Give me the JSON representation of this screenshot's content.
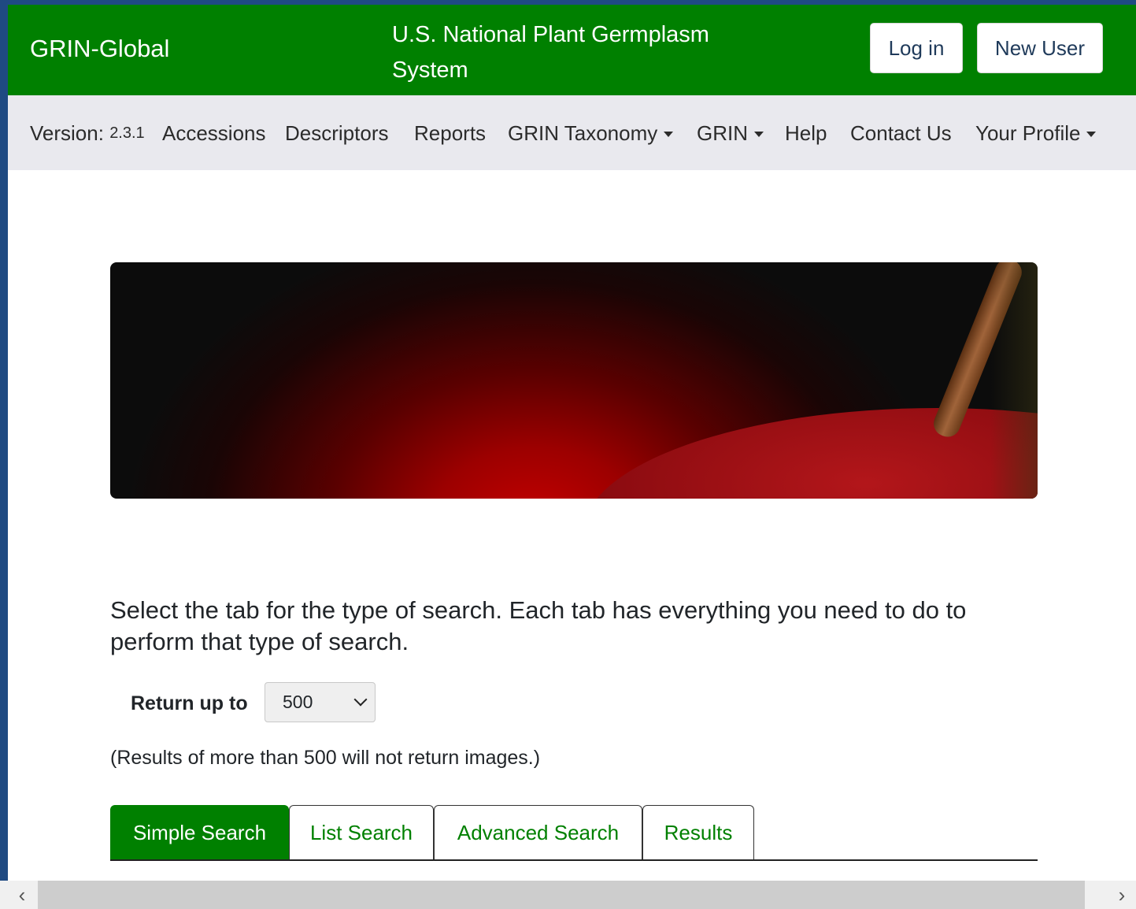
{
  "header": {
    "brand": "GRIN-Global",
    "site_title": "U.S. National Plant Germplasm System",
    "login_label": "Log in",
    "new_user_label": "New User",
    "header_color": "#008000"
  },
  "nav": {
    "version_label": "Version:",
    "version_number": "2.3.1",
    "items": [
      {
        "label": "Accessions",
        "dropdown": false
      },
      {
        "label": "Descriptors",
        "dropdown": false
      },
      {
        "label": "Reports",
        "dropdown": false
      },
      {
        "label": "GRIN Taxonomy",
        "dropdown": true
      },
      {
        "label": "GRIN",
        "dropdown": true
      },
      {
        "label": "Help",
        "dropdown": false
      },
      {
        "label": "Contact Us",
        "dropdown": false
      },
      {
        "label": "Your Profile",
        "dropdown": true
      }
    ]
  },
  "main": {
    "intro_text": "Select the tab for the type of search. Each tab has everything you need to do to perform that type of search.",
    "return_label": "Return up to",
    "return_value": "500",
    "note": "(Results of more than 500 will not return images.)",
    "tabs": [
      {
        "label": "Simple Search",
        "active": true
      },
      {
        "label": "List Search",
        "active": false
      },
      {
        "label": "Advanced Search",
        "active": false
      },
      {
        "label": "Results",
        "active": false
      }
    ]
  },
  "scrollbar": {
    "left_arrow": "‹",
    "right_arrow": "›"
  }
}
